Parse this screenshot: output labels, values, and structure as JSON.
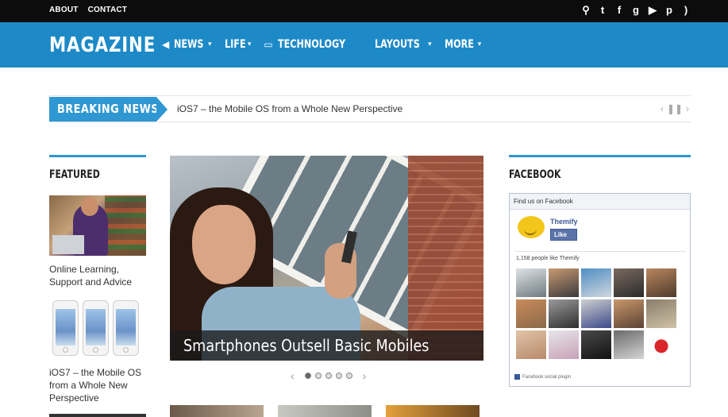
{
  "topbar": {
    "links": [
      "ABOUT",
      "CONTACT"
    ],
    "icons": [
      "search-icon",
      "twitter-icon",
      "facebook-icon",
      "google-plus-icon",
      "youtube-icon",
      "pinterest-icon",
      "rss-icon"
    ]
  },
  "header": {
    "logo": "MAGAZINE",
    "nav": [
      {
        "label": "NEWS",
        "icon": "megaphone-icon"
      },
      {
        "label": "LIFE"
      },
      {
        "label": "TECHNOLOGY",
        "icon": "laptop-icon"
      },
      {
        "label": "LAYOUTS"
      },
      {
        "label": "MORE"
      }
    ]
  },
  "breaking": {
    "label": "BREAKING NEWS",
    "headline": "iOS7 – the Mobile OS from a Whole New Perspective"
  },
  "featured": {
    "title": "FEATURED",
    "items": [
      {
        "caption": "Online Learning, Support and Advice"
      },
      {
        "caption": "iOS7 – the Mobile OS from a Whole New Perspective"
      }
    ]
  },
  "slider": {
    "caption": "Smartphones Outsell Basic Mobiles",
    "slides": 5,
    "active": 0
  },
  "facebook": {
    "title": "FACEBOOK",
    "box_header": "Find us on Facebook",
    "page_name": "Themify",
    "like_label": "Like",
    "count_text": "1,158 people like Themify",
    "footer": "Facebook social plugin"
  },
  "colors": {
    "brand": "#1d8ac7",
    "accent": "#2f97d1",
    "topbar": "#0c0c0c"
  }
}
